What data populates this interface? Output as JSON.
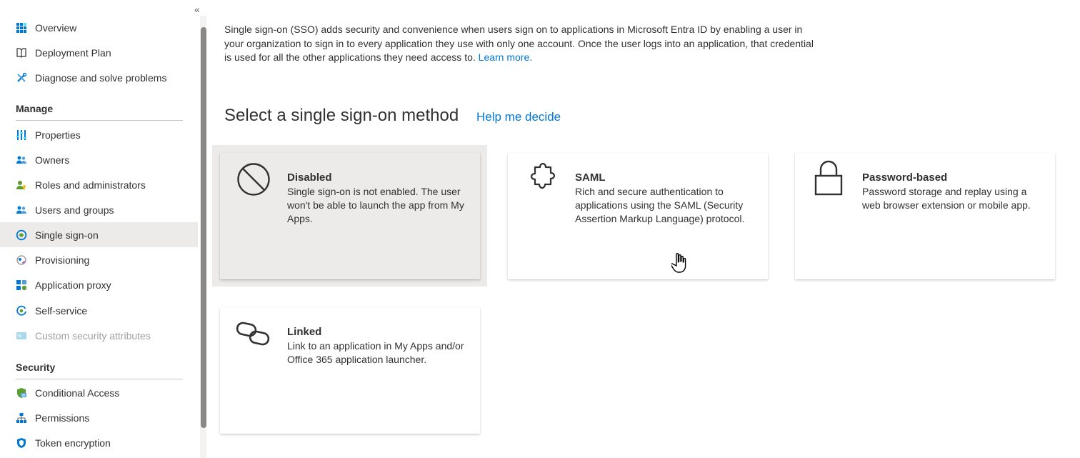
{
  "sidebar": {
    "collapse_glyph": "«",
    "top_items": [
      {
        "label": "Overview",
        "icon": "grid-icon"
      },
      {
        "label": "Deployment Plan",
        "icon": "book-icon"
      },
      {
        "label": "Diagnose and solve problems",
        "icon": "wrench-icon"
      }
    ],
    "manage_title": "Manage",
    "manage_items": [
      {
        "label": "Properties",
        "icon": "sliders-icon"
      },
      {
        "label": "Owners",
        "icon": "people-icon"
      },
      {
        "label": "Roles and administrators",
        "icon": "person-key-icon"
      },
      {
        "label": "Users and groups",
        "icon": "people-icon"
      },
      {
        "label": "Single sign-on",
        "icon": "sso-icon",
        "active": true
      },
      {
        "label": "Provisioning",
        "icon": "sync-icon"
      },
      {
        "label": "Application proxy",
        "icon": "app-proxy-icon"
      },
      {
        "label": "Self-service",
        "icon": "self-service-icon"
      },
      {
        "label": "Custom security attributes",
        "icon": "attributes-icon",
        "disabled": true
      }
    ],
    "security_title": "Security",
    "security_items": [
      {
        "label": "Conditional Access",
        "icon": "conditional-access-icon"
      },
      {
        "label": "Permissions",
        "icon": "hierarchy-icon"
      },
      {
        "label": "Token encryption",
        "icon": "shield-icon"
      }
    ]
  },
  "main": {
    "intro_text": "Single sign-on (SSO) adds security and convenience when users sign on to applications in Microsoft Entra ID by enabling a user in your organization to sign in to every application they use with only one account. Once the user logs into an application, that credential is used for all the other applications they need access to.",
    "learn_more": "Learn more.",
    "heading": "Select a single sign-on method",
    "help_link": "Help me decide",
    "cards": [
      {
        "title": "Disabled",
        "desc": "Single sign-on is not enabled. The user won't be able to launch the app from My Apps.",
        "icon": "prohibited-icon",
        "selected": true
      },
      {
        "title": "SAML",
        "desc": "Rich and secure authentication to applications using the SAML (Security Assertion Markup Language) protocol.",
        "icon": "puzzle-icon"
      },
      {
        "title": "Password-based",
        "desc": "Password storage and replay using a web browser extension or mobile app.",
        "icon": "lock-icon"
      },
      {
        "title": "Linked",
        "desc": "Link to an application in My Apps and/or Office 365 application launcher.",
        "icon": "link-icon"
      }
    ]
  },
  "colors": {
    "accent": "#0078d4",
    "selected_bg": "#edebe9",
    "text": "#323130",
    "disabled_text": "#a19f9d"
  }
}
